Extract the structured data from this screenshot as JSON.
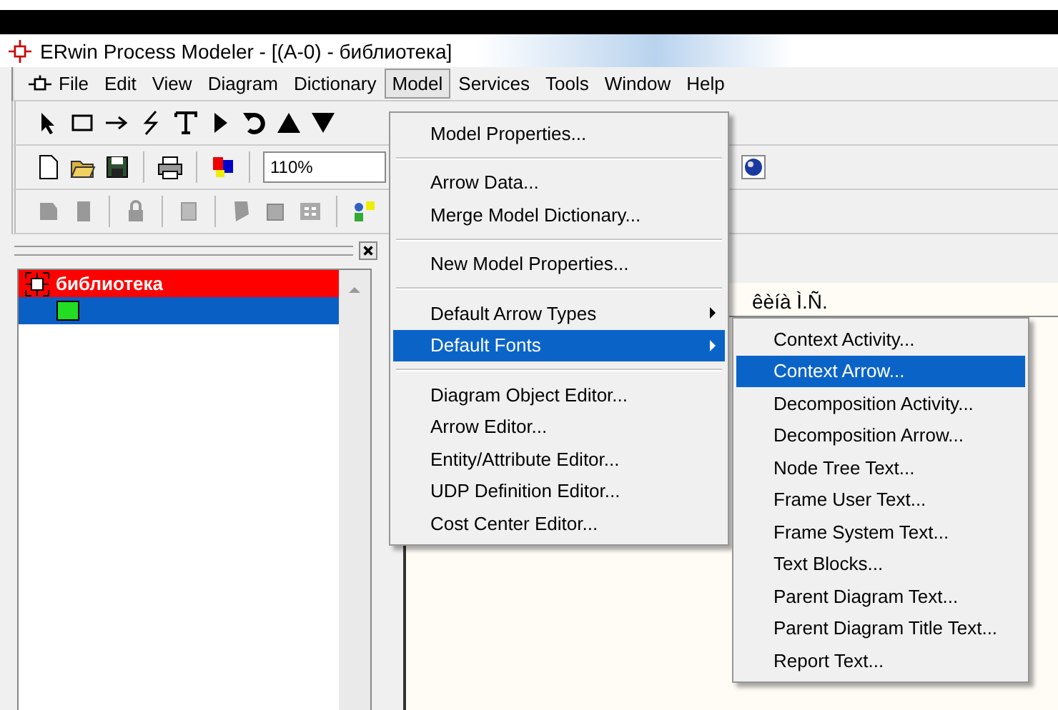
{
  "window": {
    "title": "ERwin Process Modeler - [(A-0)  - библиотека]"
  },
  "menu_bar": [
    {
      "label": "File",
      "selected": false
    },
    {
      "label": "Edit",
      "selected": false
    },
    {
      "label": "View",
      "selected": false
    },
    {
      "label": "Diagram",
      "selected": false
    },
    {
      "label": "Dictionary",
      "selected": false
    },
    {
      "label": "Model",
      "selected": true
    },
    {
      "label": "Services",
      "selected": false
    },
    {
      "label": "Tools",
      "selected": false
    },
    {
      "label": "Window",
      "selected": false
    },
    {
      "label": "Help",
      "selected": false
    }
  ],
  "toolbar": {
    "zoom": "110%"
  },
  "model_tree": [
    {
      "label": "библиотека",
      "kind": "context",
      "selected": false,
      "children": [
        {
          "kind": "activity",
          "selected": true
        }
      ]
    }
  ],
  "canvas": {
    "text": "êèíà Ì.Ñ."
  },
  "model_menu": [
    [
      {
        "label": "Model Properties...",
        "submenu": false,
        "selected": false
      }
    ],
    [
      {
        "label": "Arrow Data...",
        "submenu": false,
        "selected": false
      },
      {
        "label": "Merge Model Dictionary...",
        "submenu": false,
        "selected": false
      }
    ],
    [
      {
        "label": "New Model Properties...",
        "submenu": false,
        "selected": false
      }
    ],
    [
      {
        "label": "Default Arrow Types",
        "submenu": true,
        "selected": false
      },
      {
        "label": "Default Fonts",
        "submenu": true,
        "selected": true
      }
    ],
    [
      {
        "label": "Diagram Object Editor...",
        "submenu": false,
        "selected": false
      },
      {
        "label": "Arrow Editor...",
        "submenu": false,
        "selected": false
      },
      {
        "label": "Entity/Attribute Editor...",
        "submenu": false,
        "selected": false
      },
      {
        "label": "UDP Definition Editor...",
        "submenu": false,
        "selected": false
      },
      {
        "label": "Cost Center Editor...",
        "submenu": false,
        "selected": false
      }
    ]
  ],
  "fonts_submenu": [
    {
      "label": "Context Activity...",
      "selected": false
    },
    {
      "label": "Context Arrow...",
      "selected": true
    },
    {
      "label": "Decomposition Activity...",
      "selected": false
    },
    {
      "label": "Decomposition Arrow...",
      "selected": false
    },
    {
      "label": "Node Tree Text...",
      "selected": false
    },
    {
      "label": "Frame User Text...",
      "selected": false
    },
    {
      "label": "Frame System Text...",
      "selected": false
    },
    {
      "label": "Text Blocks...",
      "selected": false
    },
    {
      "label": "Parent Diagram Text...",
      "selected": false
    },
    {
      "label": "Parent Diagram Title Text...",
      "selected": false
    },
    {
      "label": "Report Text...",
      "selected": false
    }
  ]
}
